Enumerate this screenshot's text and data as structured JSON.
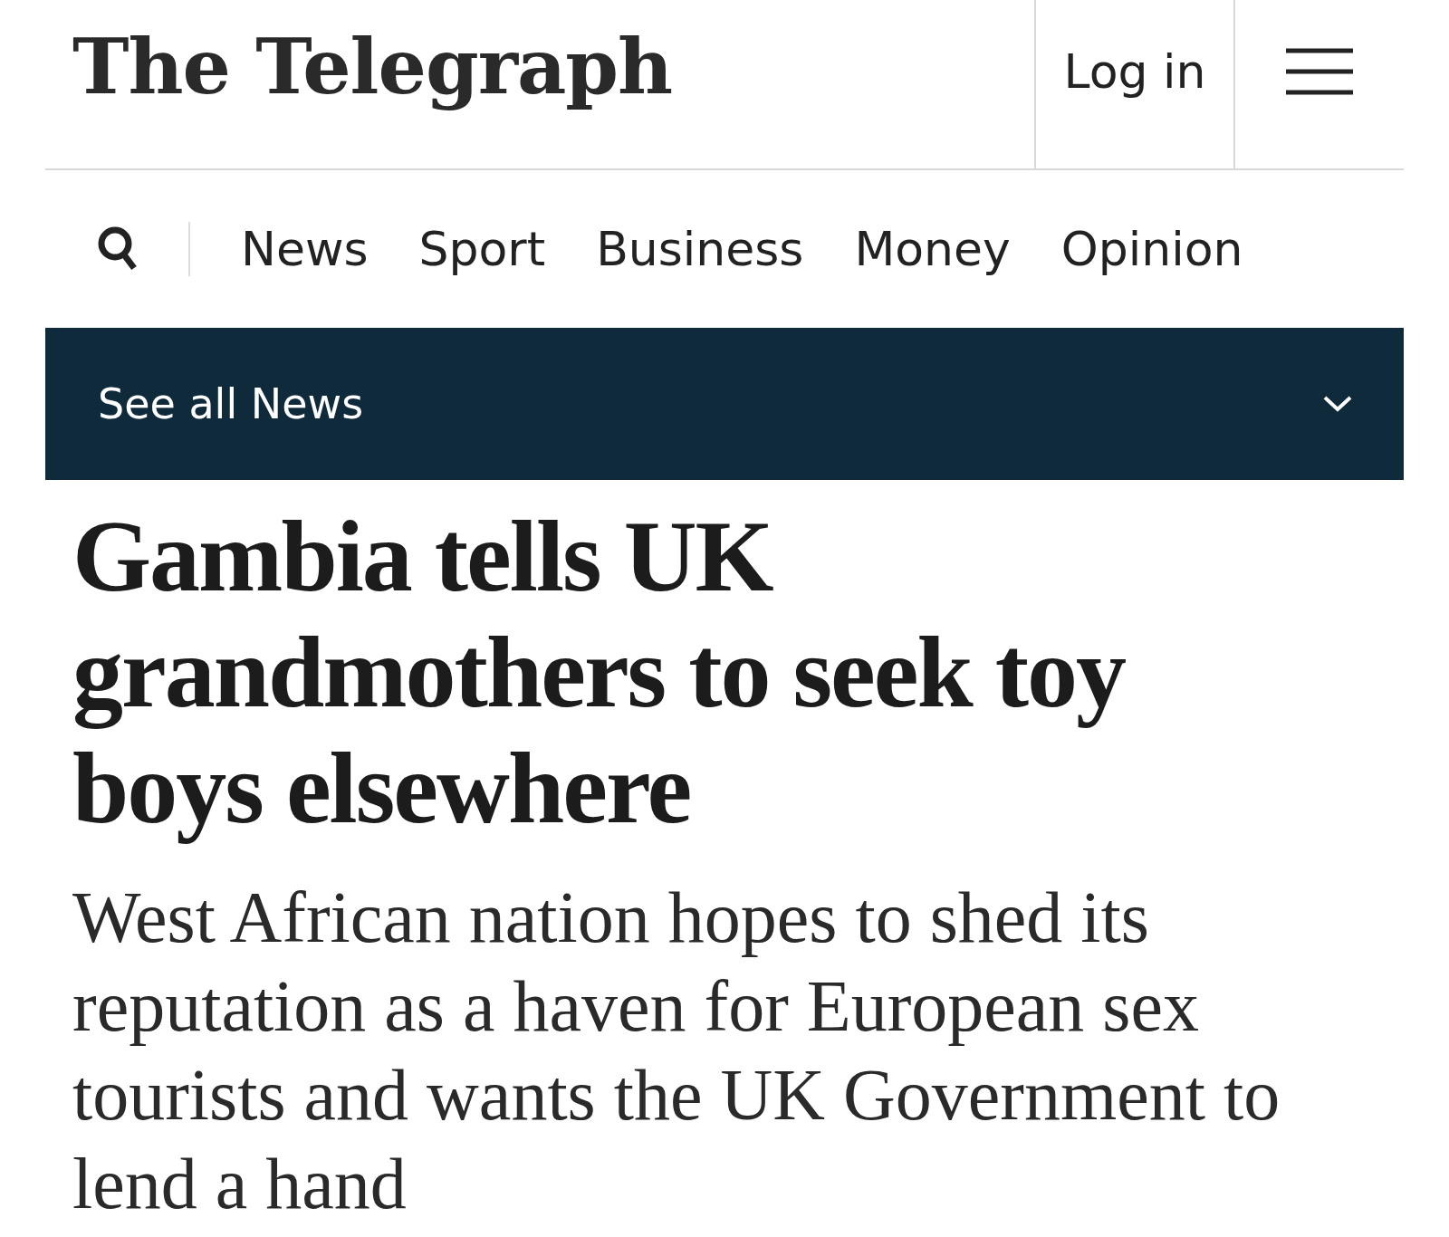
{
  "header": {
    "logo": "The Telegraph",
    "login": "Log in"
  },
  "nav": [
    {
      "label": "News"
    },
    {
      "label": "Sport"
    },
    {
      "label": "Business"
    },
    {
      "label": "Money"
    },
    {
      "label": "Opinion"
    }
  ],
  "section_bar": {
    "label": "See all News"
  },
  "article": {
    "headline": "Gambia tells UK grandmothers to seek toy boys elsewhere",
    "standfirst": "West African nation hopes to shed its reputation as a haven for European sex tourists and wants the UK Government to lend a hand"
  }
}
